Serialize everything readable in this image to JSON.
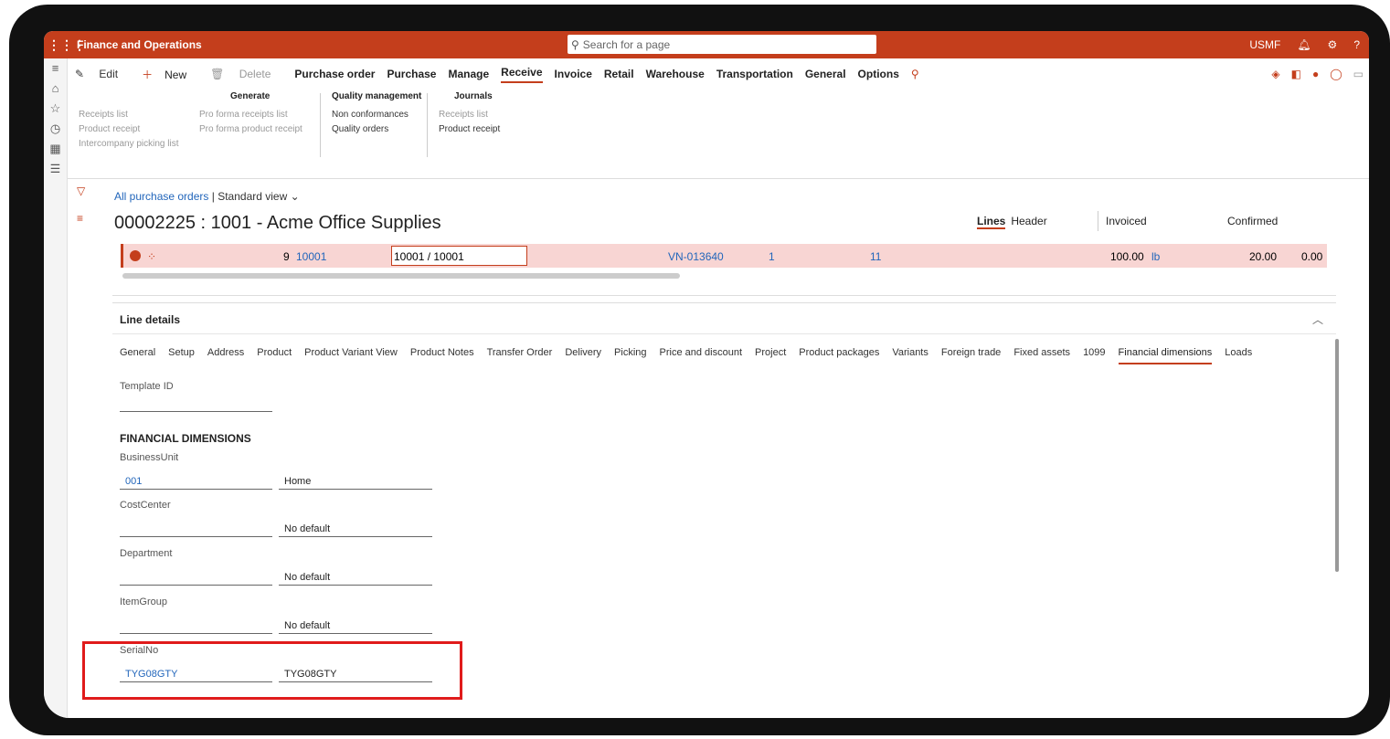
{
  "app": {
    "title": "Finance and Operations",
    "search_placeholder": "Search for a page",
    "company": "USMF"
  },
  "actionpane": {
    "tabs": [
      "Edit",
      "New",
      "Delete",
      "Purchase order",
      "Purchase",
      "Manage",
      "Receive",
      "Invoice",
      "Retail",
      "Warehouse",
      "Transportation",
      "General",
      "Options"
    ],
    "active_tab": "Receive",
    "groups": {
      "generate": {
        "title": "Generate",
        "col1": [
          "Receipts list",
          "Product receipt",
          "Intercompany picking list"
        ],
        "col2": [
          "Pro forma receipts list",
          "Pro forma product receipt"
        ]
      },
      "quality": {
        "title": "Quality management",
        "items": [
          "Non conformances",
          "Quality orders"
        ]
      },
      "journals": {
        "title": "Journals",
        "items": [
          "Receipts list",
          "Product receipt"
        ]
      }
    }
  },
  "page": {
    "breadcrumb_link": "All purchase orders",
    "breadcrumb_sep": "|",
    "breadcrumb_view": "Standard view",
    "title": "00002225 : 1001 - Acme Office Supplies",
    "view_tabs": {
      "lines": "Lines",
      "header": "Header"
    },
    "status": {
      "invoiced": "Invoiced",
      "confirmed": "Confirmed"
    }
  },
  "line_row": {
    "line_no": "9",
    "item": "10001",
    "variant_input": "10001 / 10001",
    "vendor_ref": "VN-013640",
    "col_a": "1",
    "col_b": "11",
    "quantity": "100.00",
    "unit": "lb",
    "price": "20.00",
    "extra": "0.00"
  },
  "line_details": {
    "title": "Line details",
    "tabs": [
      "General",
      "Setup",
      "Address",
      "Product",
      "Product Variant View",
      "Product Notes",
      "Transfer Order",
      "Delivery",
      "Picking",
      "Price and discount",
      "Project",
      "Product packages",
      "Variants",
      "Foreign trade",
      "Fixed assets",
      "1099",
      "Financial dimensions",
      "Loads"
    ],
    "active_tab": "Financial dimensions",
    "template_label": "Template ID",
    "section_title": "FINANCIAL DIMENSIONS",
    "dimensions": [
      {
        "label": "BusinessUnit",
        "value": "001",
        "desc": "Home"
      },
      {
        "label": "CostCenter",
        "value": "",
        "desc": "No default"
      },
      {
        "label": "Department",
        "value": "",
        "desc": "No default"
      },
      {
        "label": "ItemGroup",
        "value": "",
        "desc": "No default"
      },
      {
        "label": "SerialNo",
        "value": "TYG08GTY",
        "desc": "TYG08GTY"
      }
    ]
  },
  "colors": {
    "brand": "#c43e1c",
    "link": "#2266bb",
    "highlight": "#e01b1b"
  }
}
